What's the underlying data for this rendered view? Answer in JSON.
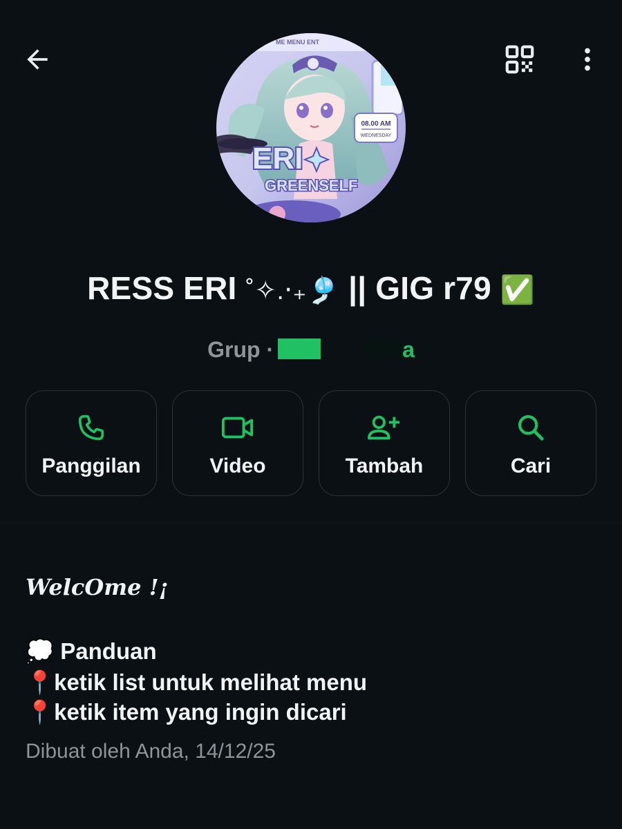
{
  "topbar": {
    "back_icon": "arrow-left-icon",
    "qr_icon": "qr-code-icon",
    "more_icon": "more-vertical-icon"
  },
  "avatar": {
    "image_text": {
      "menu_items": [
        "ME",
        "MENU",
        "ENT"
      ],
      "time": "08.00 AM",
      "day": "WEDNESDAY",
      "logo_main": "ERI",
      "logo_sub": "GREENSELF"
    }
  },
  "profile": {
    "name_prefix": "RESS ERI",
    "name_suffix": "|| GIG r79",
    "decor_emoji": "˚✧.‧₊🎐",
    "verified_emoji": "✅",
    "subtitle": "Grup ·",
    "subtitle_end": "a"
  },
  "actions": [
    {
      "label": "Panggilan",
      "icon": "phone-icon"
    },
    {
      "label": "Video",
      "icon": "video-icon"
    },
    {
      "label": "Tambah",
      "icon": "add-person-icon"
    },
    {
      "label": "Cari",
      "icon": "search-icon"
    }
  ],
  "description": {
    "welcome": "WelcOme !¡",
    "panduan_emoji": "💭",
    "panduan": "Panduan",
    "pin_emoji": "📍",
    "line1": "ketik list untuk melihat menu",
    "line2": "ketik item yang ingin dicari"
  },
  "created": "Dibuat oleh Anda, 14/12/25",
  "colors": {
    "background": "#0b1014",
    "accent_green": "#21c063",
    "text_primary": "#f1f3f4",
    "text_secondary": "#8d9599",
    "button_border": "#2c3336"
  }
}
